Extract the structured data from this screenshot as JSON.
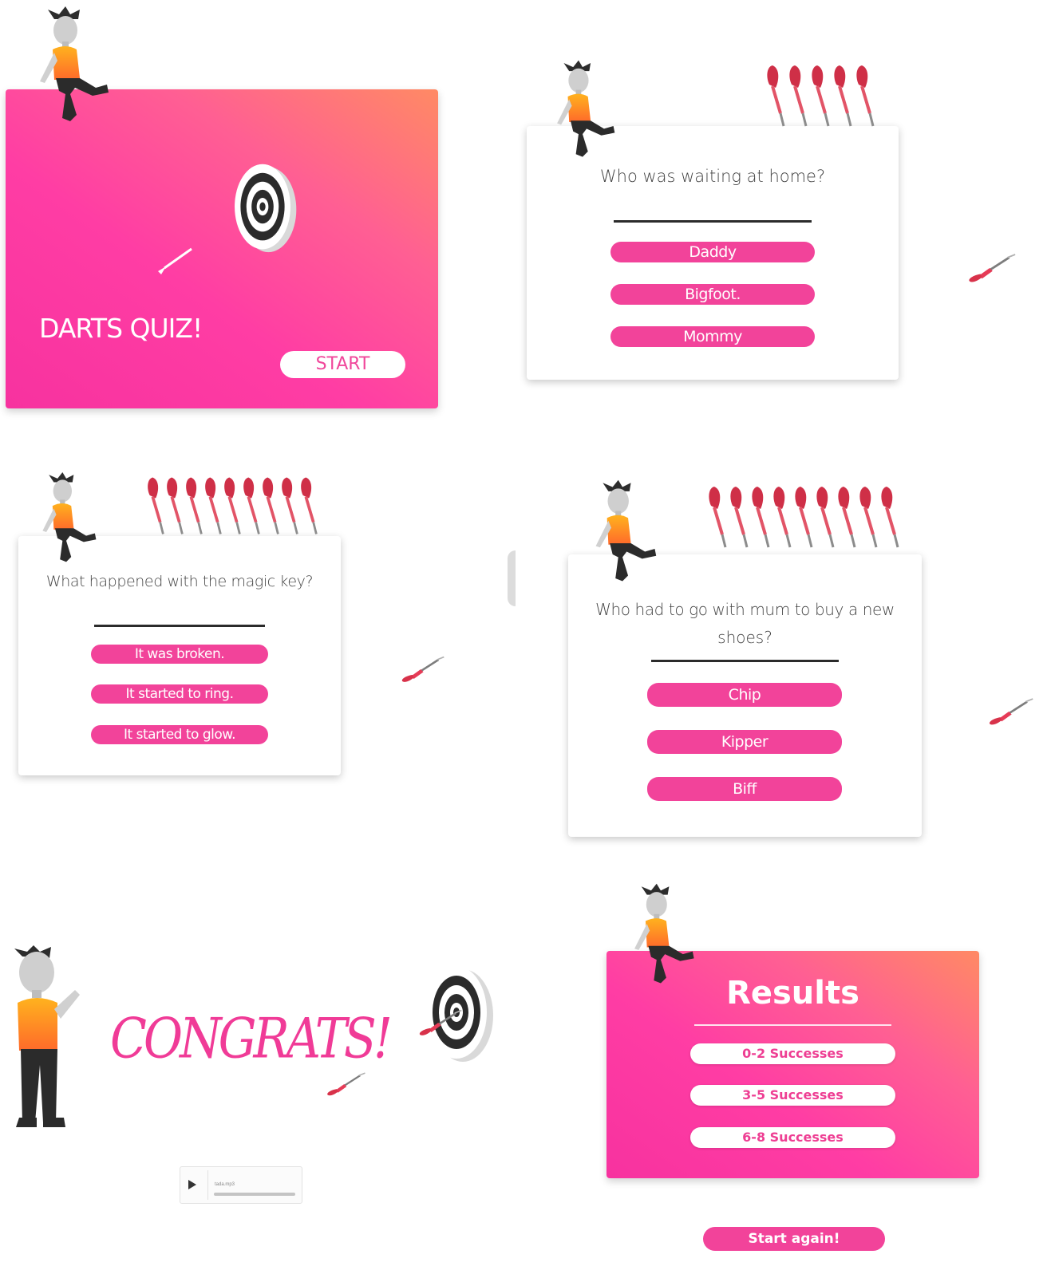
{
  "screens": {
    "intro": {
      "title": "DARTS QUIZ!",
      "start_label": "START"
    },
    "question1": {
      "text": "Who was waiting at home?",
      "answers": [
        "Daddy",
        "Bigfoot.",
        "Mommy"
      ]
    },
    "question2": {
      "text": "What happened with the magic key?",
      "answers": [
        "It was broken.",
        "It started to ring.",
        "It started to glow."
      ]
    },
    "question3": {
      "text_line1": "Who had to go with mum to buy a new",
      "text_line2": "shoes?",
      "answers": [
        "Chip",
        "Kipper",
        "Biff"
      ]
    },
    "congrats": {
      "title": "CONGRATS!",
      "audio_file": "tada.mp3"
    },
    "results": {
      "title": "Results",
      "options": [
        "0-2 Successes",
        "3-5 Successes",
        "6-8 Successes"
      ],
      "restart_label": "Start again!"
    }
  },
  "icons": {
    "character": "cartoon-character-icon",
    "dart": "dart-icon",
    "dartboard": "dartboard-icon",
    "play": "play-icon"
  },
  "colors": {
    "accent_pink": "#f2439a",
    "gradient_orange": "#ff8a64",
    "gradient_pink": "#f7329f",
    "dart_red": "#d8324a",
    "character_shirt": "#ff9b1e"
  }
}
